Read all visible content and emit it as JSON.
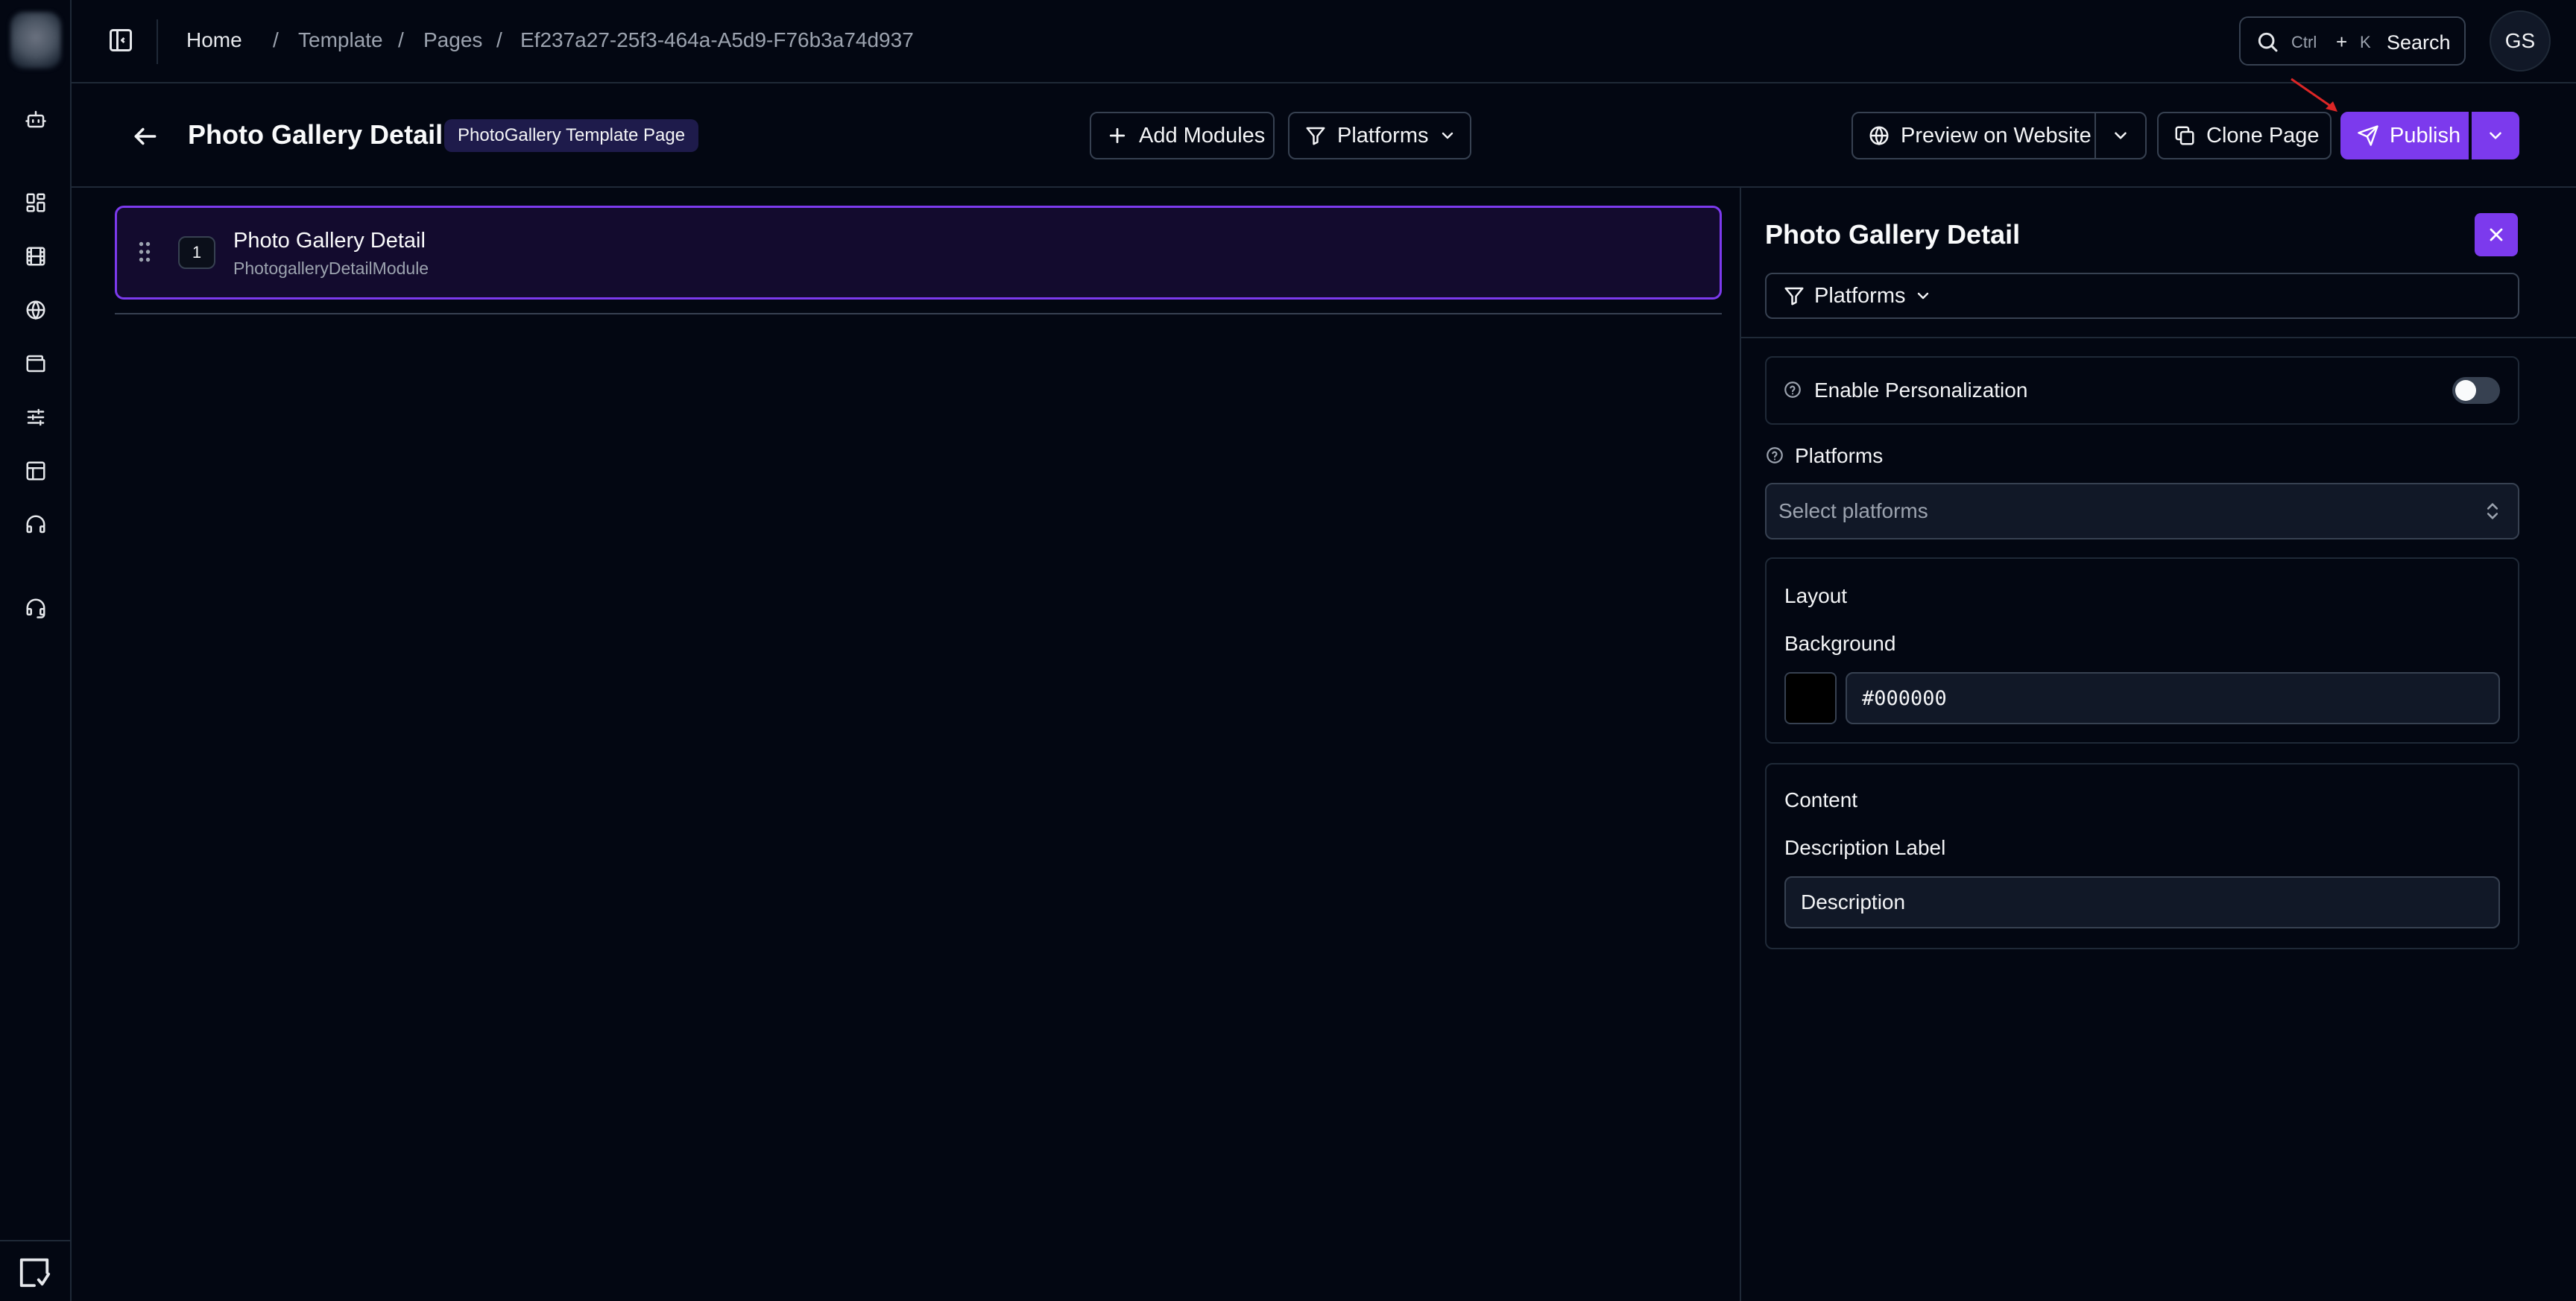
{
  "breadcrumb": {
    "home": "Home",
    "template": "Template",
    "pages": "Pages",
    "page_id": "Ef237a27-25f3-464a-A5d9-F76b3a74d937",
    "separator": "/"
  },
  "search": {
    "kbd_ctrl": "Ctrl",
    "kbd_plus": "+",
    "kbd_k": "K",
    "label": "Search"
  },
  "user": {
    "initials": "GS"
  },
  "sidebar": {
    "icons": [
      "bot-icon",
      "dashboard-icon",
      "film-icon",
      "globe-icon",
      "wallet-icon",
      "sliders-icon",
      "layout-icon",
      "headphones-icon",
      "headset-icon"
    ]
  },
  "page": {
    "title": "Photo Gallery Detail",
    "tag": "PhotoGallery Template Page"
  },
  "toolbar": {
    "add_modules": "Add Modules",
    "platforms": "Platforms",
    "preview": "Preview on Website",
    "clone": "Clone Page",
    "publish": "Publish"
  },
  "modules": [
    {
      "index": "1",
      "title": "Photo Gallery Detail",
      "subtitle": "PhotogalleryDetailModule"
    }
  ],
  "panel": {
    "title": "Photo Gallery Detail",
    "platforms_filter": "Platforms",
    "enable_personalization": "Enable Personalization",
    "personalization_enabled": false,
    "platforms_label": "Platforms",
    "platforms_placeholder": "Select platforms",
    "layout_heading": "Layout",
    "background_label": "Background",
    "background_value": "#000000",
    "content_heading": "Content",
    "description_label": "Description Label",
    "description_value": "Description"
  },
  "colors": {
    "accent": "#7c3aed",
    "background": "#030712",
    "annotation_arrow": "#dc2626"
  }
}
